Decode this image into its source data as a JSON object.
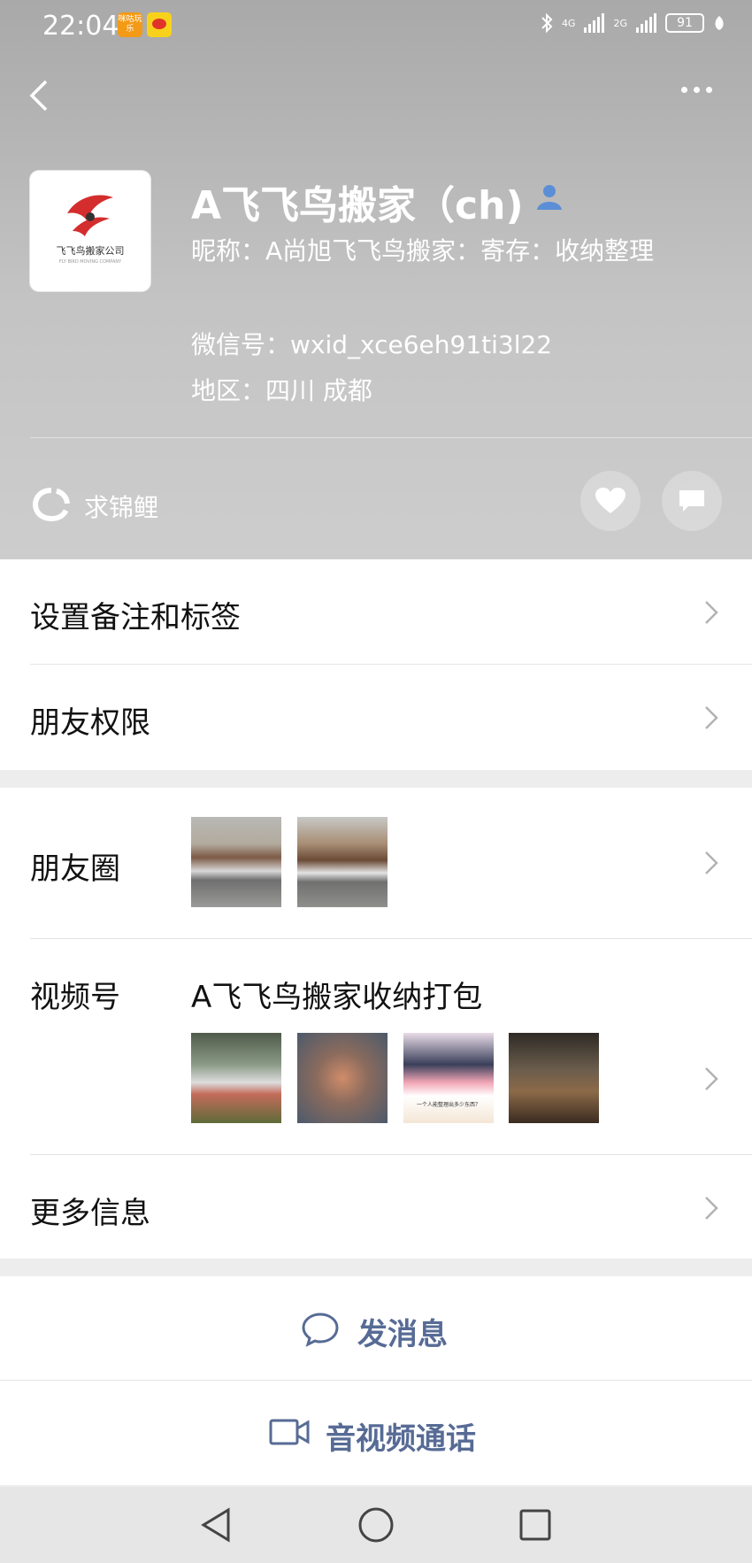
{
  "status_bar": {
    "time": "22:04",
    "app_badge_text": "咪咕玩乐",
    "network_4g": "4G",
    "network_2g": "2G",
    "battery": "91"
  },
  "header": {
    "avatar_logo_text": "飞飞鸟搬家公司",
    "avatar_logo_sub": "FLY BIRD MOVING COMPANY",
    "name": "A飞飞鸟搬家（ch)",
    "nickname": "昵称：A尚旭飞飞鸟搬家：寄存：收纳整理",
    "wechat_id": "微信号：wxid_xce6eh91ti3l22",
    "region": "地区：四川  成都",
    "koi_label": "求锦鲤"
  },
  "menu": {
    "remark_label": "设置备注和标签",
    "permissions_label": "朋友权限",
    "moments_label": "朋友圈",
    "channels_label": "视频号",
    "channels_title": "A飞飞鸟搬家收纳打包",
    "channels_thumb3_caption": "一个人能整理出多少东西？",
    "more_info_label": "更多信息"
  },
  "actions": {
    "message_label": "发消息",
    "call_label": "音视频通话"
  },
  "colors": {
    "accent": "#576b95",
    "header_bg": "#b7b7b7",
    "page_bg": "#ededed"
  }
}
